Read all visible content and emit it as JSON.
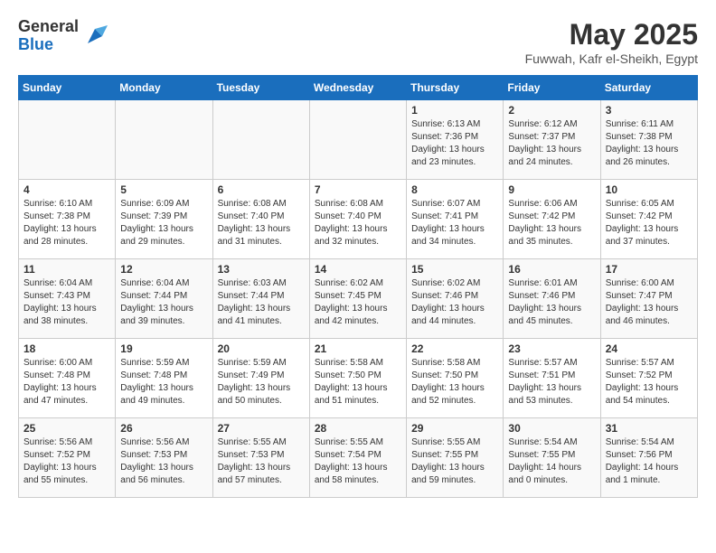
{
  "logo": {
    "general": "General",
    "blue": "Blue"
  },
  "title": "May 2025",
  "subtitle": "Fuwwah, Kafr el-Sheikh, Egypt",
  "weekdays": [
    "Sunday",
    "Monday",
    "Tuesday",
    "Wednesday",
    "Thursday",
    "Friday",
    "Saturday"
  ],
  "weeks": [
    [
      {
        "day": "",
        "info": ""
      },
      {
        "day": "",
        "info": ""
      },
      {
        "day": "",
        "info": ""
      },
      {
        "day": "",
        "info": ""
      },
      {
        "day": "1",
        "info": "Sunrise: 6:13 AM\nSunset: 7:36 PM\nDaylight: 13 hours\nand 23 minutes."
      },
      {
        "day": "2",
        "info": "Sunrise: 6:12 AM\nSunset: 7:37 PM\nDaylight: 13 hours\nand 24 minutes."
      },
      {
        "day": "3",
        "info": "Sunrise: 6:11 AM\nSunset: 7:38 PM\nDaylight: 13 hours\nand 26 minutes."
      }
    ],
    [
      {
        "day": "4",
        "info": "Sunrise: 6:10 AM\nSunset: 7:38 PM\nDaylight: 13 hours\nand 28 minutes."
      },
      {
        "day": "5",
        "info": "Sunrise: 6:09 AM\nSunset: 7:39 PM\nDaylight: 13 hours\nand 29 minutes."
      },
      {
        "day": "6",
        "info": "Sunrise: 6:08 AM\nSunset: 7:40 PM\nDaylight: 13 hours\nand 31 minutes."
      },
      {
        "day": "7",
        "info": "Sunrise: 6:08 AM\nSunset: 7:40 PM\nDaylight: 13 hours\nand 32 minutes."
      },
      {
        "day": "8",
        "info": "Sunrise: 6:07 AM\nSunset: 7:41 PM\nDaylight: 13 hours\nand 34 minutes."
      },
      {
        "day": "9",
        "info": "Sunrise: 6:06 AM\nSunset: 7:42 PM\nDaylight: 13 hours\nand 35 minutes."
      },
      {
        "day": "10",
        "info": "Sunrise: 6:05 AM\nSunset: 7:42 PM\nDaylight: 13 hours\nand 37 minutes."
      }
    ],
    [
      {
        "day": "11",
        "info": "Sunrise: 6:04 AM\nSunset: 7:43 PM\nDaylight: 13 hours\nand 38 minutes."
      },
      {
        "day": "12",
        "info": "Sunrise: 6:04 AM\nSunset: 7:44 PM\nDaylight: 13 hours\nand 39 minutes."
      },
      {
        "day": "13",
        "info": "Sunrise: 6:03 AM\nSunset: 7:44 PM\nDaylight: 13 hours\nand 41 minutes."
      },
      {
        "day": "14",
        "info": "Sunrise: 6:02 AM\nSunset: 7:45 PM\nDaylight: 13 hours\nand 42 minutes."
      },
      {
        "day": "15",
        "info": "Sunrise: 6:02 AM\nSunset: 7:46 PM\nDaylight: 13 hours\nand 44 minutes."
      },
      {
        "day": "16",
        "info": "Sunrise: 6:01 AM\nSunset: 7:46 PM\nDaylight: 13 hours\nand 45 minutes."
      },
      {
        "day": "17",
        "info": "Sunrise: 6:00 AM\nSunset: 7:47 PM\nDaylight: 13 hours\nand 46 minutes."
      }
    ],
    [
      {
        "day": "18",
        "info": "Sunrise: 6:00 AM\nSunset: 7:48 PM\nDaylight: 13 hours\nand 47 minutes."
      },
      {
        "day": "19",
        "info": "Sunrise: 5:59 AM\nSunset: 7:48 PM\nDaylight: 13 hours\nand 49 minutes."
      },
      {
        "day": "20",
        "info": "Sunrise: 5:59 AM\nSunset: 7:49 PM\nDaylight: 13 hours\nand 50 minutes."
      },
      {
        "day": "21",
        "info": "Sunrise: 5:58 AM\nSunset: 7:50 PM\nDaylight: 13 hours\nand 51 minutes."
      },
      {
        "day": "22",
        "info": "Sunrise: 5:58 AM\nSunset: 7:50 PM\nDaylight: 13 hours\nand 52 minutes."
      },
      {
        "day": "23",
        "info": "Sunrise: 5:57 AM\nSunset: 7:51 PM\nDaylight: 13 hours\nand 53 minutes."
      },
      {
        "day": "24",
        "info": "Sunrise: 5:57 AM\nSunset: 7:52 PM\nDaylight: 13 hours\nand 54 minutes."
      }
    ],
    [
      {
        "day": "25",
        "info": "Sunrise: 5:56 AM\nSunset: 7:52 PM\nDaylight: 13 hours\nand 55 minutes."
      },
      {
        "day": "26",
        "info": "Sunrise: 5:56 AM\nSunset: 7:53 PM\nDaylight: 13 hours\nand 56 minutes."
      },
      {
        "day": "27",
        "info": "Sunrise: 5:55 AM\nSunset: 7:53 PM\nDaylight: 13 hours\nand 57 minutes."
      },
      {
        "day": "28",
        "info": "Sunrise: 5:55 AM\nSunset: 7:54 PM\nDaylight: 13 hours\nand 58 minutes."
      },
      {
        "day": "29",
        "info": "Sunrise: 5:55 AM\nSunset: 7:55 PM\nDaylight: 13 hours\nand 59 minutes."
      },
      {
        "day": "30",
        "info": "Sunrise: 5:54 AM\nSunset: 7:55 PM\nDaylight: 14 hours\nand 0 minutes."
      },
      {
        "day": "31",
        "info": "Sunrise: 5:54 AM\nSunset: 7:56 PM\nDaylight: 14 hours\nand 1 minute."
      }
    ]
  ]
}
